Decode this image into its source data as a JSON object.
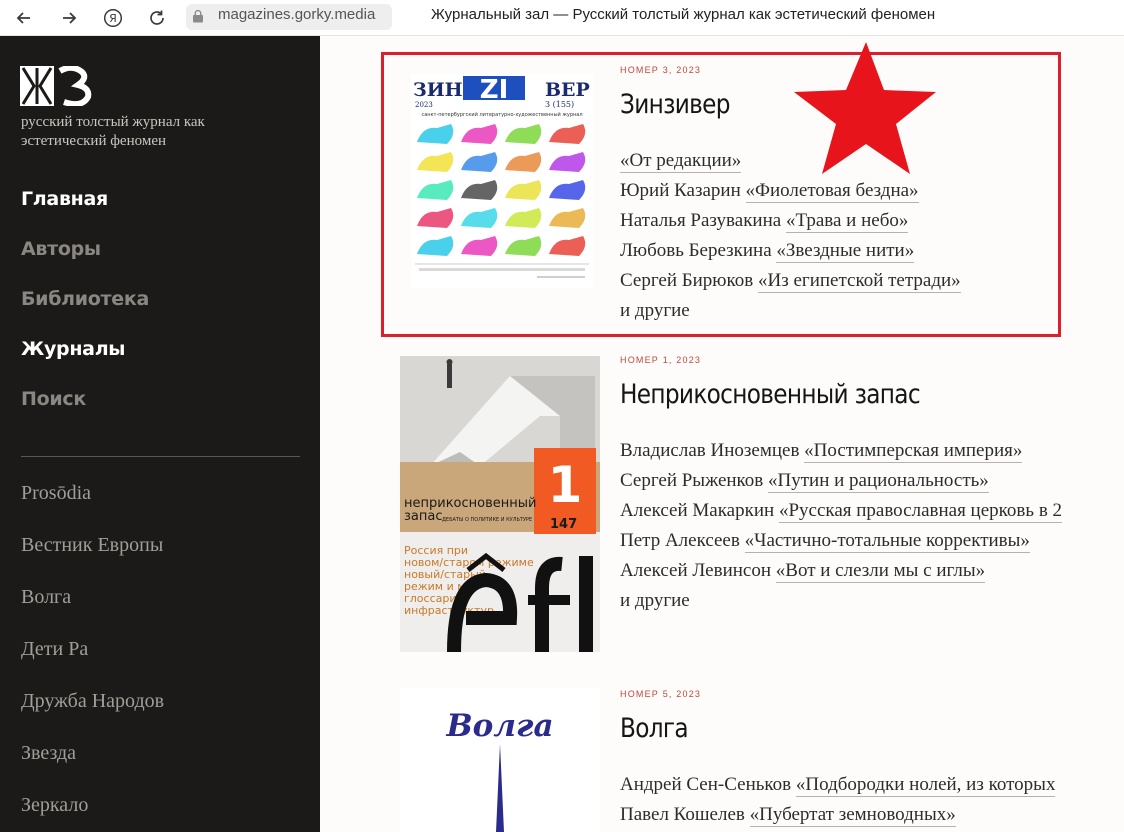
{
  "browser": {
    "url": "magazines.gorky.media",
    "tab_title": "Журнальный зал — Русский толстый журнал как эстетический феномен"
  },
  "sidebar": {
    "logo_text": "ЖЗ",
    "caption": "русский толстый журнал как эстетический феномен",
    "nav": [
      {
        "label": "Главная",
        "active": true
      },
      {
        "label": "Авторы",
        "active": false
      },
      {
        "label": "Библиотека",
        "active": false
      },
      {
        "label": "Журналы",
        "active": true
      },
      {
        "label": "Поиск",
        "active": false
      }
    ],
    "magazines": [
      "Prosōdia",
      "Вестник Европы",
      "Волга",
      "Дети Ра",
      "Дружба Народов",
      "Звезда",
      "Зеркало"
    ]
  },
  "issues": [
    {
      "issue": "НОМЕР 3, 2023",
      "title": "Зинзивер",
      "cover": {
        "brand_left": "ЗИН",
        "brand_mid": "ZI",
        "brand_right": "ВЕР",
        "year": "2023",
        "number": "3 (155)",
        "subtitle": "санкт-петербургский литературно-художественный журнал"
      },
      "entries": [
        {
          "author": "",
          "work": "«От редакции»"
        },
        {
          "author": "Юрий Казарин",
          "work": "«Фиолетовая бездна»"
        },
        {
          "author": "Наталья Разувакина",
          "work": "«Трава и небо»"
        },
        {
          "author": "Любовь Березкина",
          "work": "«Звездные нити»"
        },
        {
          "author": "Сергей Бирюков",
          "work": "«Из египетской тетради»"
        }
      ],
      "more": "и другие"
    },
    {
      "issue": "НОМЕР 1, 2023",
      "title": "Неприкосновенный запас",
      "cover": {
        "number": "1",
        "issue_no": "147",
        "name_line1": "неприкосновенный",
        "name_line2": "запас",
        "tagline": "ДЕБАТЫ О ПОЛИТИКЕ И КУЛЬТУРЕ",
        "bullets": [
          "Россия при",
          "новом/старом режиме",
          "новый/старый",
          "режим и мир",
          "глоссарий",
          "инфраструктур"
        ]
      },
      "entries": [
        {
          "author": "Владислав Иноземцев",
          "work": "«Постимперская империя»"
        },
        {
          "author": "Сергей Рыженков",
          "work": "«Путин и рациональность»"
        },
        {
          "author": "Алексей Макаркин",
          "work": "«Русская православная церковь в 2"
        },
        {
          "author": "Петр Алексеев",
          "work": "«Частично-тотальные коррективы»"
        },
        {
          "author": "Алексей Левинсон",
          "work": "«Вот и слезли мы с иглы»"
        }
      ],
      "more": "и другие"
    },
    {
      "issue": "НОМЕР 5, 2023",
      "title": "Волга",
      "cover": {
        "brand": "Волга"
      },
      "entries": [
        {
          "author": "Андрей Сен-Сеньков",
          "work": "«Подбородки нолей, из которых"
        },
        {
          "author": "Павел Кошелев",
          "work": "«Пубертат земноводных»"
        }
      ]
    }
  ],
  "colors": {
    "accent_red": "#dc1f2d",
    "sidebar_bg": "#1b1a19",
    "issue_label": "#c2473a"
  }
}
